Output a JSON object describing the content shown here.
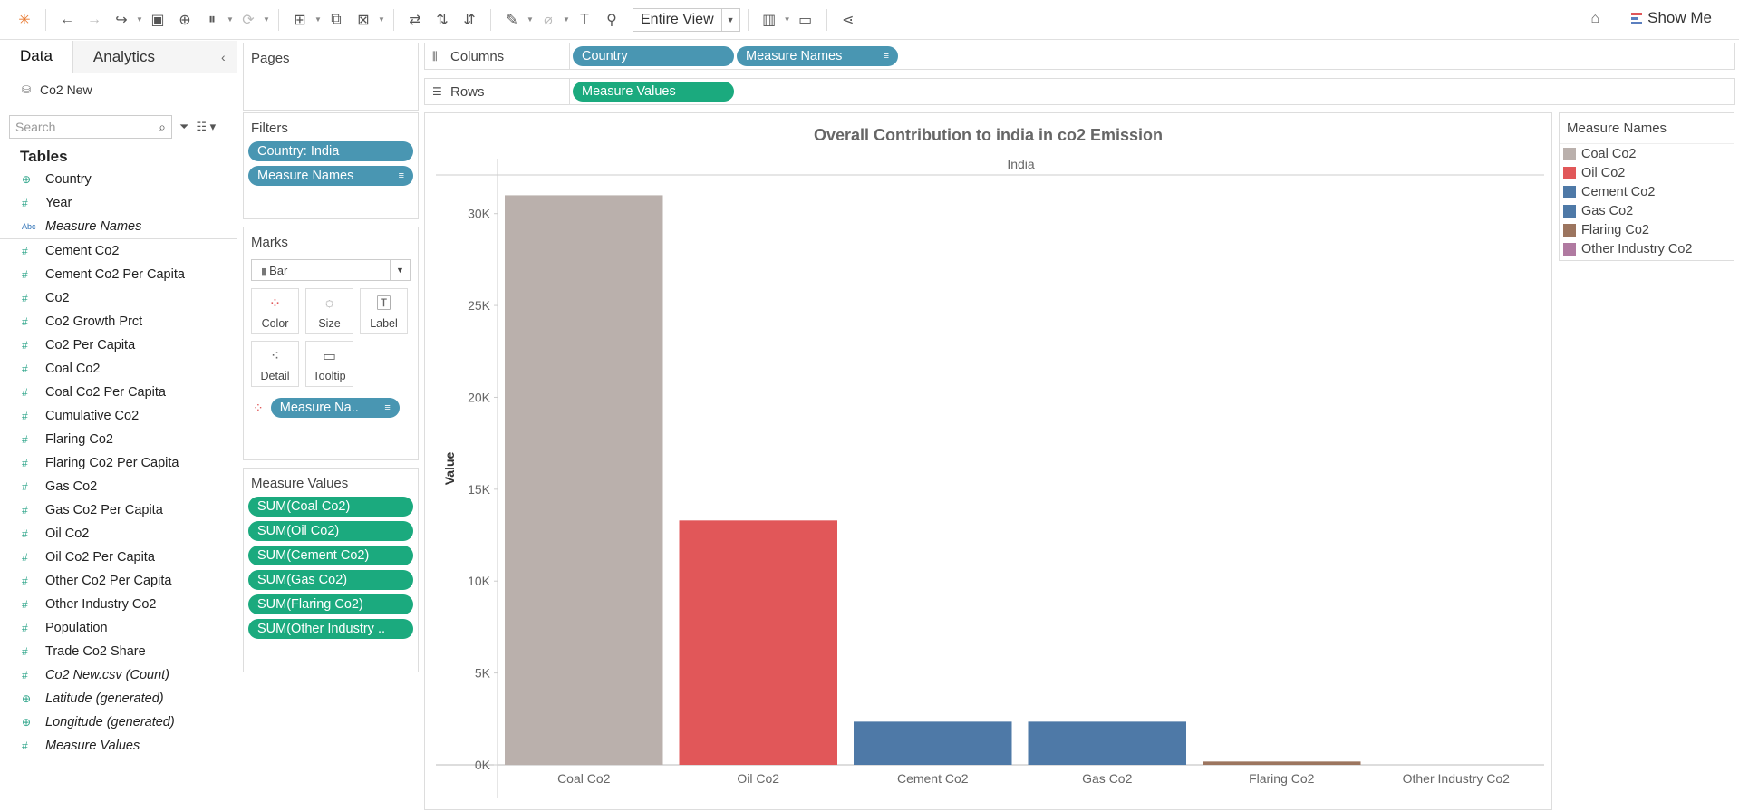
{
  "toolbar": {
    "fit_value": "Entire View",
    "show_me_label": "Show Me"
  },
  "data_pane": {
    "tab_data": "Data",
    "tab_analytics": "Analytics",
    "datasource": "Co2 New",
    "search_placeholder": "Search",
    "tables_heading": "Tables",
    "dimension_fields": [
      {
        "label": "Country",
        "type": "geo",
        "italic": false
      },
      {
        "label": "Year",
        "type": "num",
        "italic": false
      },
      {
        "label": "Measure Names",
        "type": "abc",
        "italic": true
      }
    ],
    "measure_fields": [
      {
        "label": "Cement Co2",
        "type": "num",
        "italic": false
      },
      {
        "label": "Cement Co2 Per Capita",
        "type": "num",
        "italic": false
      },
      {
        "label": "Co2",
        "type": "num",
        "italic": false
      },
      {
        "label": "Co2 Growth Prct",
        "type": "num",
        "italic": false
      },
      {
        "label": "Co2 Per Capita",
        "type": "num",
        "italic": false
      },
      {
        "label": "Coal Co2",
        "type": "num",
        "italic": false
      },
      {
        "label": "Coal Co2 Per Capita",
        "type": "num",
        "italic": false
      },
      {
        "label": "Cumulative Co2",
        "type": "num",
        "italic": false
      },
      {
        "label": "Flaring Co2",
        "type": "num",
        "italic": false
      },
      {
        "label": "Flaring Co2 Per Capita",
        "type": "num",
        "italic": false
      },
      {
        "label": "Gas Co2",
        "type": "num",
        "italic": false
      },
      {
        "label": "Gas Co2 Per Capita",
        "type": "num",
        "italic": false
      },
      {
        "label": "Oil Co2",
        "type": "num",
        "italic": false
      },
      {
        "label": "Oil Co2 Per Capita",
        "type": "num",
        "italic": false
      },
      {
        "label": "Other Co2 Per Capita",
        "type": "num",
        "italic": false
      },
      {
        "label": "Other Industry Co2",
        "type": "num",
        "italic": false
      },
      {
        "label": "Population",
        "type": "num",
        "italic": false
      },
      {
        "label": "Trade Co2 Share",
        "type": "num",
        "italic": false
      },
      {
        "label": "Co2 New.csv (Count)",
        "type": "num",
        "italic": true
      },
      {
        "label": "Latitude (generated)",
        "type": "geo",
        "italic": true
      },
      {
        "label": "Longitude (generated)",
        "type": "geo",
        "italic": true
      },
      {
        "label": "Measure Values",
        "type": "num",
        "italic": true
      }
    ]
  },
  "pages": {
    "title": "Pages"
  },
  "filters": {
    "title": "Filters",
    "pills": [
      "Country: India",
      "Measure Names"
    ]
  },
  "marks": {
    "title": "Marks",
    "type": "Bar",
    "buttons": {
      "color": "Color",
      "size": "Size",
      "label": "Label",
      "detail": "Detail",
      "tooltip": "Tooltip"
    },
    "color_pill": "Measure Na.."
  },
  "measure_values_card": {
    "title": "Measure Values",
    "pills": [
      "SUM(Coal Co2)",
      "SUM(Oil Co2)",
      "SUM(Cement Co2)",
      "SUM(Gas Co2)",
      "SUM(Flaring Co2)",
      "SUM(Other Industry .."
    ]
  },
  "shelves": {
    "columns_label": "Columns",
    "rows_label": "Rows",
    "columns_pills": [
      "Country",
      "Measure Names"
    ],
    "rows_pills": [
      "Measure Values"
    ]
  },
  "legend": {
    "title": "Measure Names",
    "items": [
      {
        "label": "Coal Co2",
        "color": "#bab0ac"
      },
      {
        "label": "Oil Co2",
        "color": "#e15759"
      },
      {
        "label": "Cement Co2",
        "color": "#4e79a7"
      },
      {
        "label": "Gas Co2",
        "color": "#4e79a7"
      },
      {
        "label": "Flaring Co2",
        "color": "#9c755f"
      },
      {
        "label": "Other Industry Co2",
        "color": "#b07aa1"
      }
    ]
  },
  "chart_data": {
    "type": "bar",
    "title": "Overall Contribution to india in co2 Emission",
    "pane_header": "India",
    "ylabel": "Value",
    "xlabel": "",
    "categories": [
      "Coal Co2",
      "Oil Co2",
      "Cement Co2",
      "Gas Co2",
      "Flaring Co2",
      "Other Industry Co2"
    ],
    "values": [
      31000,
      13300,
      2350,
      2350,
      180,
      0
    ],
    "colors": [
      "#bab0ac",
      "#e15759",
      "#4e79a7",
      "#4e79a7",
      "#9c755f",
      "#b07aa1"
    ],
    "ylim": [
      0,
      32500
    ],
    "yticks": [
      0,
      5000,
      10000,
      15000,
      20000,
      25000,
      30000
    ],
    "ytick_labels": [
      "0K",
      "5K",
      "10K",
      "15K",
      "20K",
      "25K",
      "30K"
    ],
    "grid": false,
    "legend": "right"
  }
}
